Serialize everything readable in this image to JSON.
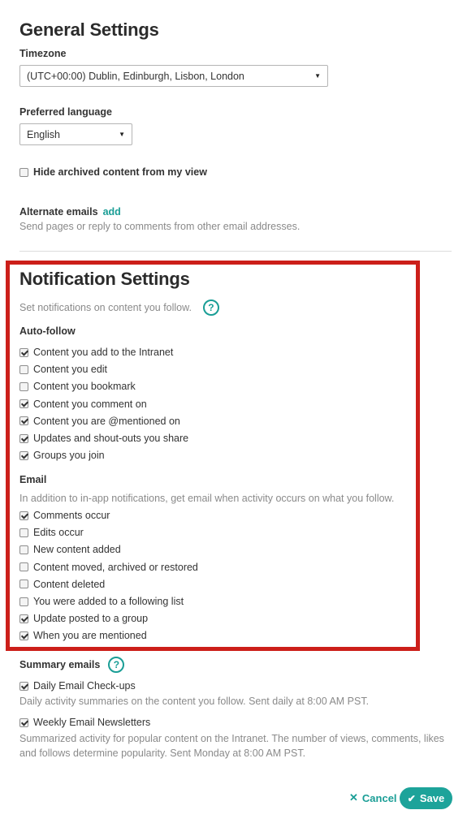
{
  "general": {
    "title": "General Settings",
    "timezone_label": "Timezone",
    "timezone_value": "(UTC+00:00) Dublin, Edinburgh, Lisbon, London",
    "language_label": "Preferred language",
    "language_value": "English",
    "hide_archived_label": "Hide archived content from my view",
    "hide_archived_checked": false,
    "alternate_emails_label": "Alternate emails",
    "alternate_emails_add": "add",
    "alternate_emails_desc": "Send pages or reply to comments from other email addresses."
  },
  "notifications": {
    "title": "Notification Settings",
    "subtitle": "Set notifications on content you follow.",
    "help_glyph": "?",
    "autofollow_label": "Auto-follow",
    "autofollow": [
      {
        "label": "Content you add to the Intranet",
        "checked": true
      },
      {
        "label": "Content you edit",
        "checked": false
      },
      {
        "label": "Content you bookmark",
        "checked": false
      },
      {
        "label": "Content you comment on",
        "checked": true
      },
      {
        "label": "Content you are @mentioned on",
        "checked": true
      },
      {
        "label": "Updates and shout-outs you share",
        "checked": true
      },
      {
        "label": "Groups you join",
        "checked": true
      }
    ],
    "email_label": "Email",
    "email_desc": "In addition to in-app notifications, get email when activity occurs on what you follow.",
    "email": [
      {
        "label": "Comments occur",
        "checked": true
      },
      {
        "label": "Edits occur",
        "checked": false
      },
      {
        "label": "New content added",
        "checked": false
      },
      {
        "label": "Content moved, archived or restored",
        "checked": false
      },
      {
        "label": "Content deleted",
        "checked": false
      },
      {
        "label": "You were added to a following list",
        "checked": false
      },
      {
        "label": "Update posted to a group",
        "checked": true
      },
      {
        "label": "When you are mentioned",
        "checked": true
      }
    ]
  },
  "summary": {
    "label": "Summary emails",
    "help_glyph": "?",
    "daily_label": "Daily Email Check-ups",
    "daily_checked": true,
    "daily_desc": "Daily activity summaries on the content you follow. Sent daily at 8:00 AM PST.",
    "weekly_label": "Weekly Email Newsletters",
    "weekly_checked": true,
    "weekly_desc_line1": "Summarized activity for popular content on the Intranet. The number of views, comments, likes",
    "weekly_desc_line2": "and follows determine popularity. Sent Monday at 8:00 AM PST."
  },
  "actions": {
    "cancel_label": "Cancel",
    "save_label": "Save"
  },
  "colors": {
    "accent": "#1a9e96",
    "highlight_box": "#cc1f1a"
  }
}
